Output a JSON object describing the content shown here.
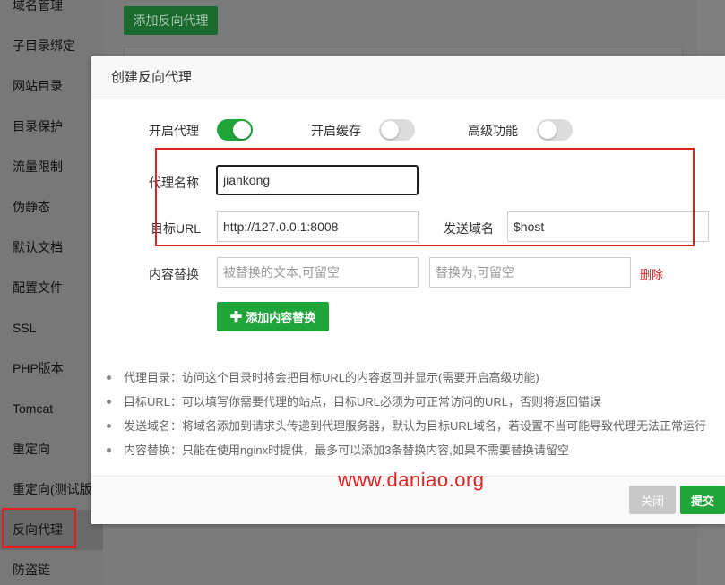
{
  "sidebar": {
    "items": [
      {
        "label": "域名管理"
      },
      {
        "label": "子目录绑定"
      },
      {
        "label": "网站目录"
      },
      {
        "label": "目录保护"
      },
      {
        "label": "流量限制"
      },
      {
        "label": "伪静态"
      },
      {
        "label": "默认文档"
      },
      {
        "label": "配置文件"
      },
      {
        "label": "SSL"
      },
      {
        "label": "PHP版本"
      },
      {
        "label": "Tomcat"
      },
      {
        "label": "重定向"
      },
      {
        "label": "重定向(测试版)"
      },
      {
        "label": "反向代理"
      },
      {
        "label": "防盗链"
      }
    ]
  },
  "main": {
    "add_button": "添加反向代理"
  },
  "dialog": {
    "title": "创建反向代理",
    "toggles": {
      "proxy": {
        "label": "开启代理",
        "on": true
      },
      "cache": {
        "label": "开启缓存",
        "on": false
      },
      "advanced": {
        "label": "高级功能",
        "on": false
      }
    },
    "proxy_name": {
      "label": "代理名称",
      "value": "jiankong"
    },
    "target_url": {
      "label": "目标URL",
      "value": "http://127.0.0.1:8008"
    },
    "send_domain": {
      "label": "发送域名",
      "value": "$host"
    },
    "content_replace": {
      "label": "内容替换",
      "from_placeholder": "被替换的文本,可留空",
      "to_placeholder": "替换为,可留空",
      "delete_label": "删除"
    },
    "add_replace_button": "添加内容替换",
    "notes": [
      "代理目录：访问这个目录时将会把目标URL的内容返回并显示(需要开启高级功能)",
      "目标URL：可以填写你需要代理的站点，目标URL必须为可正常访问的URL，否则将返回错误",
      "发送域名：将域名添加到请求头传递到代理服务器，默认为目标URL域名，若设置不当可能导致代理无法正常运行",
      "内容替换：只能在使用nginx时提供，最多可以添加3条替换内容,如果不需要替换请留空"
    ],
    "watermark": "www.daniao.org",
    "close_button": "关闭",
    "submit_button": "提交"
  },
  "colors": {
    "accent": "#20a53a",
    "highlight_box": "#e02020",
    "delete_link": "#e02020"
  }
}
